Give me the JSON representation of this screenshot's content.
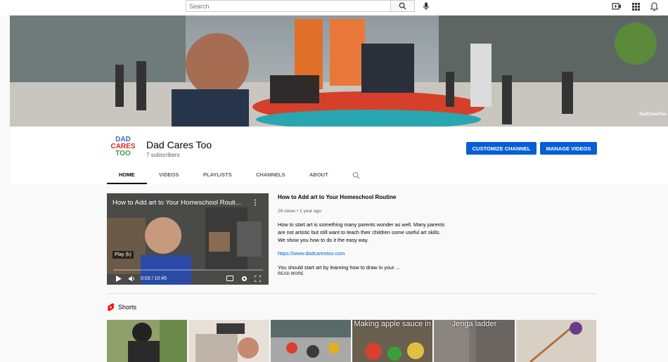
{
  "topbar": {
    "search_placeholder": "Search",
    "icons": [
      "search-icon",
      "mic-icon",
      "create-video-icon",
      "apps-icon",
      "bell-icon"
    ]
  },
  "banner": {
    "watermark": "DadCaresToo"
  },
  "channel": {
    "logo_lines": [
      "DAD",
      "CARES",
      "TOO"
    ],
    "logo_colors": [
      "#2a6fdb",
      "#e02424",
      "#3aa13a"
    ],
    "name": "Dad Cares Too",
    "subscribers": "7 subscribers",
    "customize_label": "CUSTOMIZE CHANNEL",
    "manage_label": "MANAGE VIDEOS",
    "tabs": [
      "HOME",
      "VIDEOS",
      "PLAYLISTS",
      "CHANNELS",
      "ABOUT"
    ],
    "active_tab": "HOME"
  },
  "featured": {
    "player_title": "How to Add art to Your Homeschool Routi...",
    "play_tooltip": "Play (k)",
    "time": "0:03 / 10:45",
    "progress_fraction": 0.005,
    "title": "How to Add art to Your Homeschool Routine",
    "meta": "26 views • 1 year ago",
    "description": "How to start art is something many parents wonder as well. Many parents are not artistic but still want to teach their children some useful art skills. We show you how to do it the easy way.",
    "link": "https://www.dadcarestoo.com",
    "more_text": "You should start art by learning how to draw in your ...",
    "read_more": "READ MORE"
  },
  "shorts": {
    "label": "Shorts",
    "thumb_texts": [
      "",
      "",
      "",
      "Making apple sauce in",
      "Jenga ladder",
      ""
    ]
  },
  "colors": {
    "accent": "#065fd4",
    "shorts_red": "#ff0000"
  }
}
